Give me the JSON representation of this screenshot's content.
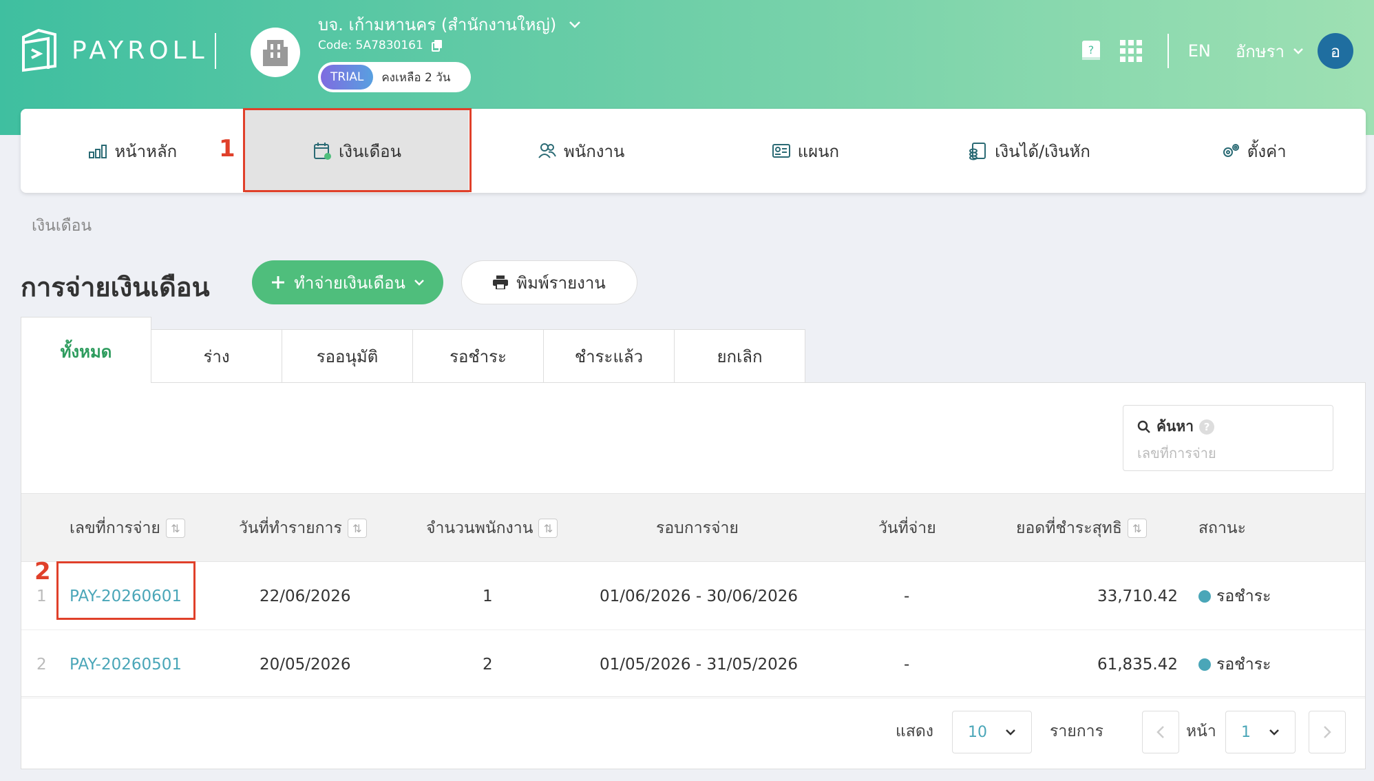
{
  "brand": {
    "logo_text": "PAYROLL"
  },
  "company": {
    "name": "บจ. เก้ามหานคร (สำนักงานใหญ่)",
    "code": "Code: 5A7830161",
    "trial_badge": "TRIAL",
    "trial_remaining": "คงเหลือ 2 วัน"
  },
  "header": {
    "language": "EN",
    "user_name": "อักษรา",
    "user_initial": "อ"
  },
  "nav": {
    "items": [
      {
        "label": "หน้าหลัก",
        "icon": "chart-bar-icon"
      },
      {
        "label": "เงินเดือน",
        "icon": "calendar-money-icon",
        "active": true
      },
      {
        "label": "พนักงาน",
        "icon": "users-icon"
      },
      {
        "label": "แผนก",
        "icon": "id-card-icon"
      },
      {
        "label": "เงินได้/เงินหัก",
        "icon": "coins-doc-icon"
      },
      {
        "label": "ตั้งค่า",
        "icon": "gears-icon"
      }
    ]
  },
  "annotations": {
    "marker_1": "1",
    "marker_2": "2"
  },
  "breadcrumb": "เงินเดือน",
  "page": {
    "title": "การจ่ายเงินเดือน",
    "create_button": "ทำจ่ายเงินเดือน",
    "print_button": "พิมพ์รายงาน"
  },
  "tabs": [
    "ทั้งหมด",
    "ร่าง",
    "รออนุมัติ",
    "รอชำระ",
    "ชำระแล้ว",
    "ยกเลิก"
  ],
  "search": {
    "label": "ค้นหา",
    "help": "?",
    "placeholder": "เลขที่การจ่าย"
  },
  "table": {
    "headers": {
      "pay_no": "เลขที่การจ่าย",
      "created_date": "วันที่ทำรายการ",
      "employee_count": "จำนวนพนักงาน",
      "pay_period": "รอบการจ่าย",
      "pay_date": "วันที่จ่าย",
      "net_amount": "ยอดที่ชำระสุทธิ",
      "status": "สถานะ"
    },
    "rows": [
      {
        "index": "1",
        "pay_no": "PAY-20260601",
        "created_date": "22/06/2026",
        "employee_count": "1",
        "pay_period": "01/06/2026 - 30/06/2026",
        "pay_date": "-",
        "net_amount": "33,710.42",
        "status": "รอชำระ"
      },
      {
        "index": "2",
        "pay_no": "PAY-20260501",
        "created_date": "20/05/2026",
        "employee_count": "2",
        "pay_period": "01/05/2026 - 31/05/2026",
        "pay_date": "-",
        "net_amount": "61,835.42",
        "status": "รอชำระ"
      }
    ]
  },
  "pagination": {
    "show_label": "แสดง",
    "page_size": "10",
    "items_label": "รายการ",
    "page_label": "หน้า",
    "current_page": "1"
  },
  "colors": {
    "accent_green": "#4fbe7c",
    "link_teal": "#4aa6b8",
    "highlight_red": "#e0402a"
  }
}
